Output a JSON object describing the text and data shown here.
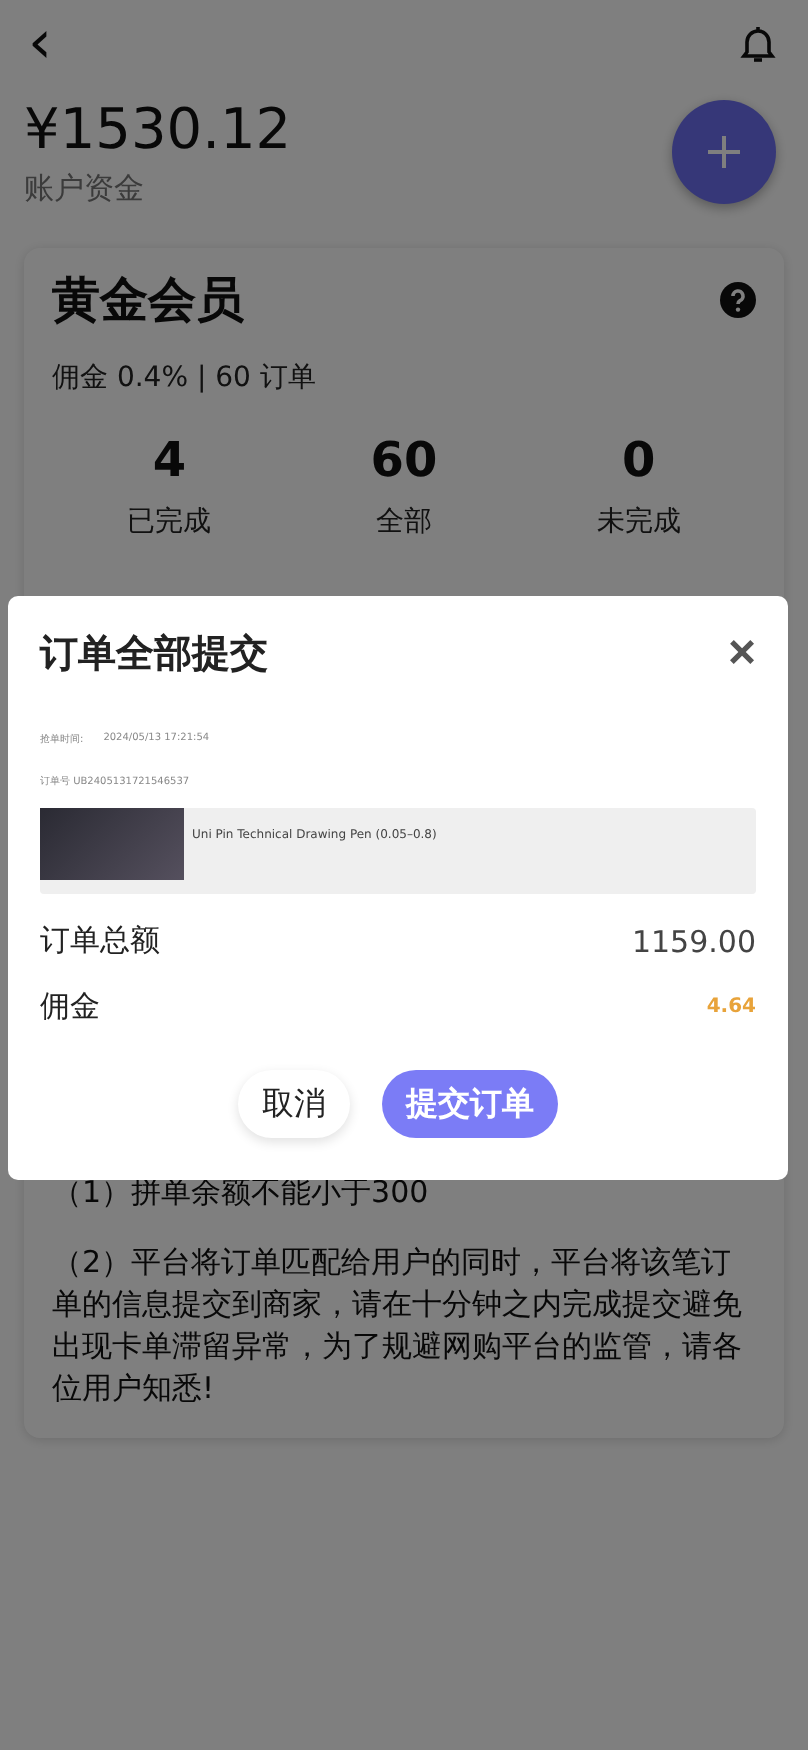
{
  "header": {
    "back": "‹"
  },
  "balance": {
    "amount": "¥1530.12",
    "label": "账户资金"
  },
  "member": {
    "title": "黄金会员",
    "subtitle": "佣金 0.4% | 60 订单",
    "stats": [
      {
        "value": "4",
        "label": "已完成"
      },
      {
        "value": "60",
        "label": "全部"
      },
      {
        "value": "0",
        "label": "未完成"
      }
    ]
  },
  "rules": [
    "（1）拼单余额不能小于300",
    "（2）平台将订单匹配给用户的同时，平台将该笔订单的信息提交到商家，请在十分钟之内完成提交避免出现卡单滞留异常，为了规避网购平台的监管，请各位用户知悉!"
  ],
  "dialog": {
    "title": "订单全部提交",
    "close": "×",
    "time_label": "抢单时间:",
    "time": "2024/05/13 17:21:54",
    "order_no": "订单号 UB2405131721546537",
    "product": "Uni Pin Technical Drawing Pen (0.05–0.8)",
    "rows": [
      {
        "label": "订单总额",
        "value": "1159.00",
        "kind": "plain"
      },
      {
        "label": "佣金",
        "value": "4.64",
        "kind": "highlight"
      }
    ],
    "buttons": [
      {
        "label": "取消",
        "kind": "secondary"
      },
      {
        "label": "提交订单",
        "kind": "primary"
      }
    ]
  }
}
